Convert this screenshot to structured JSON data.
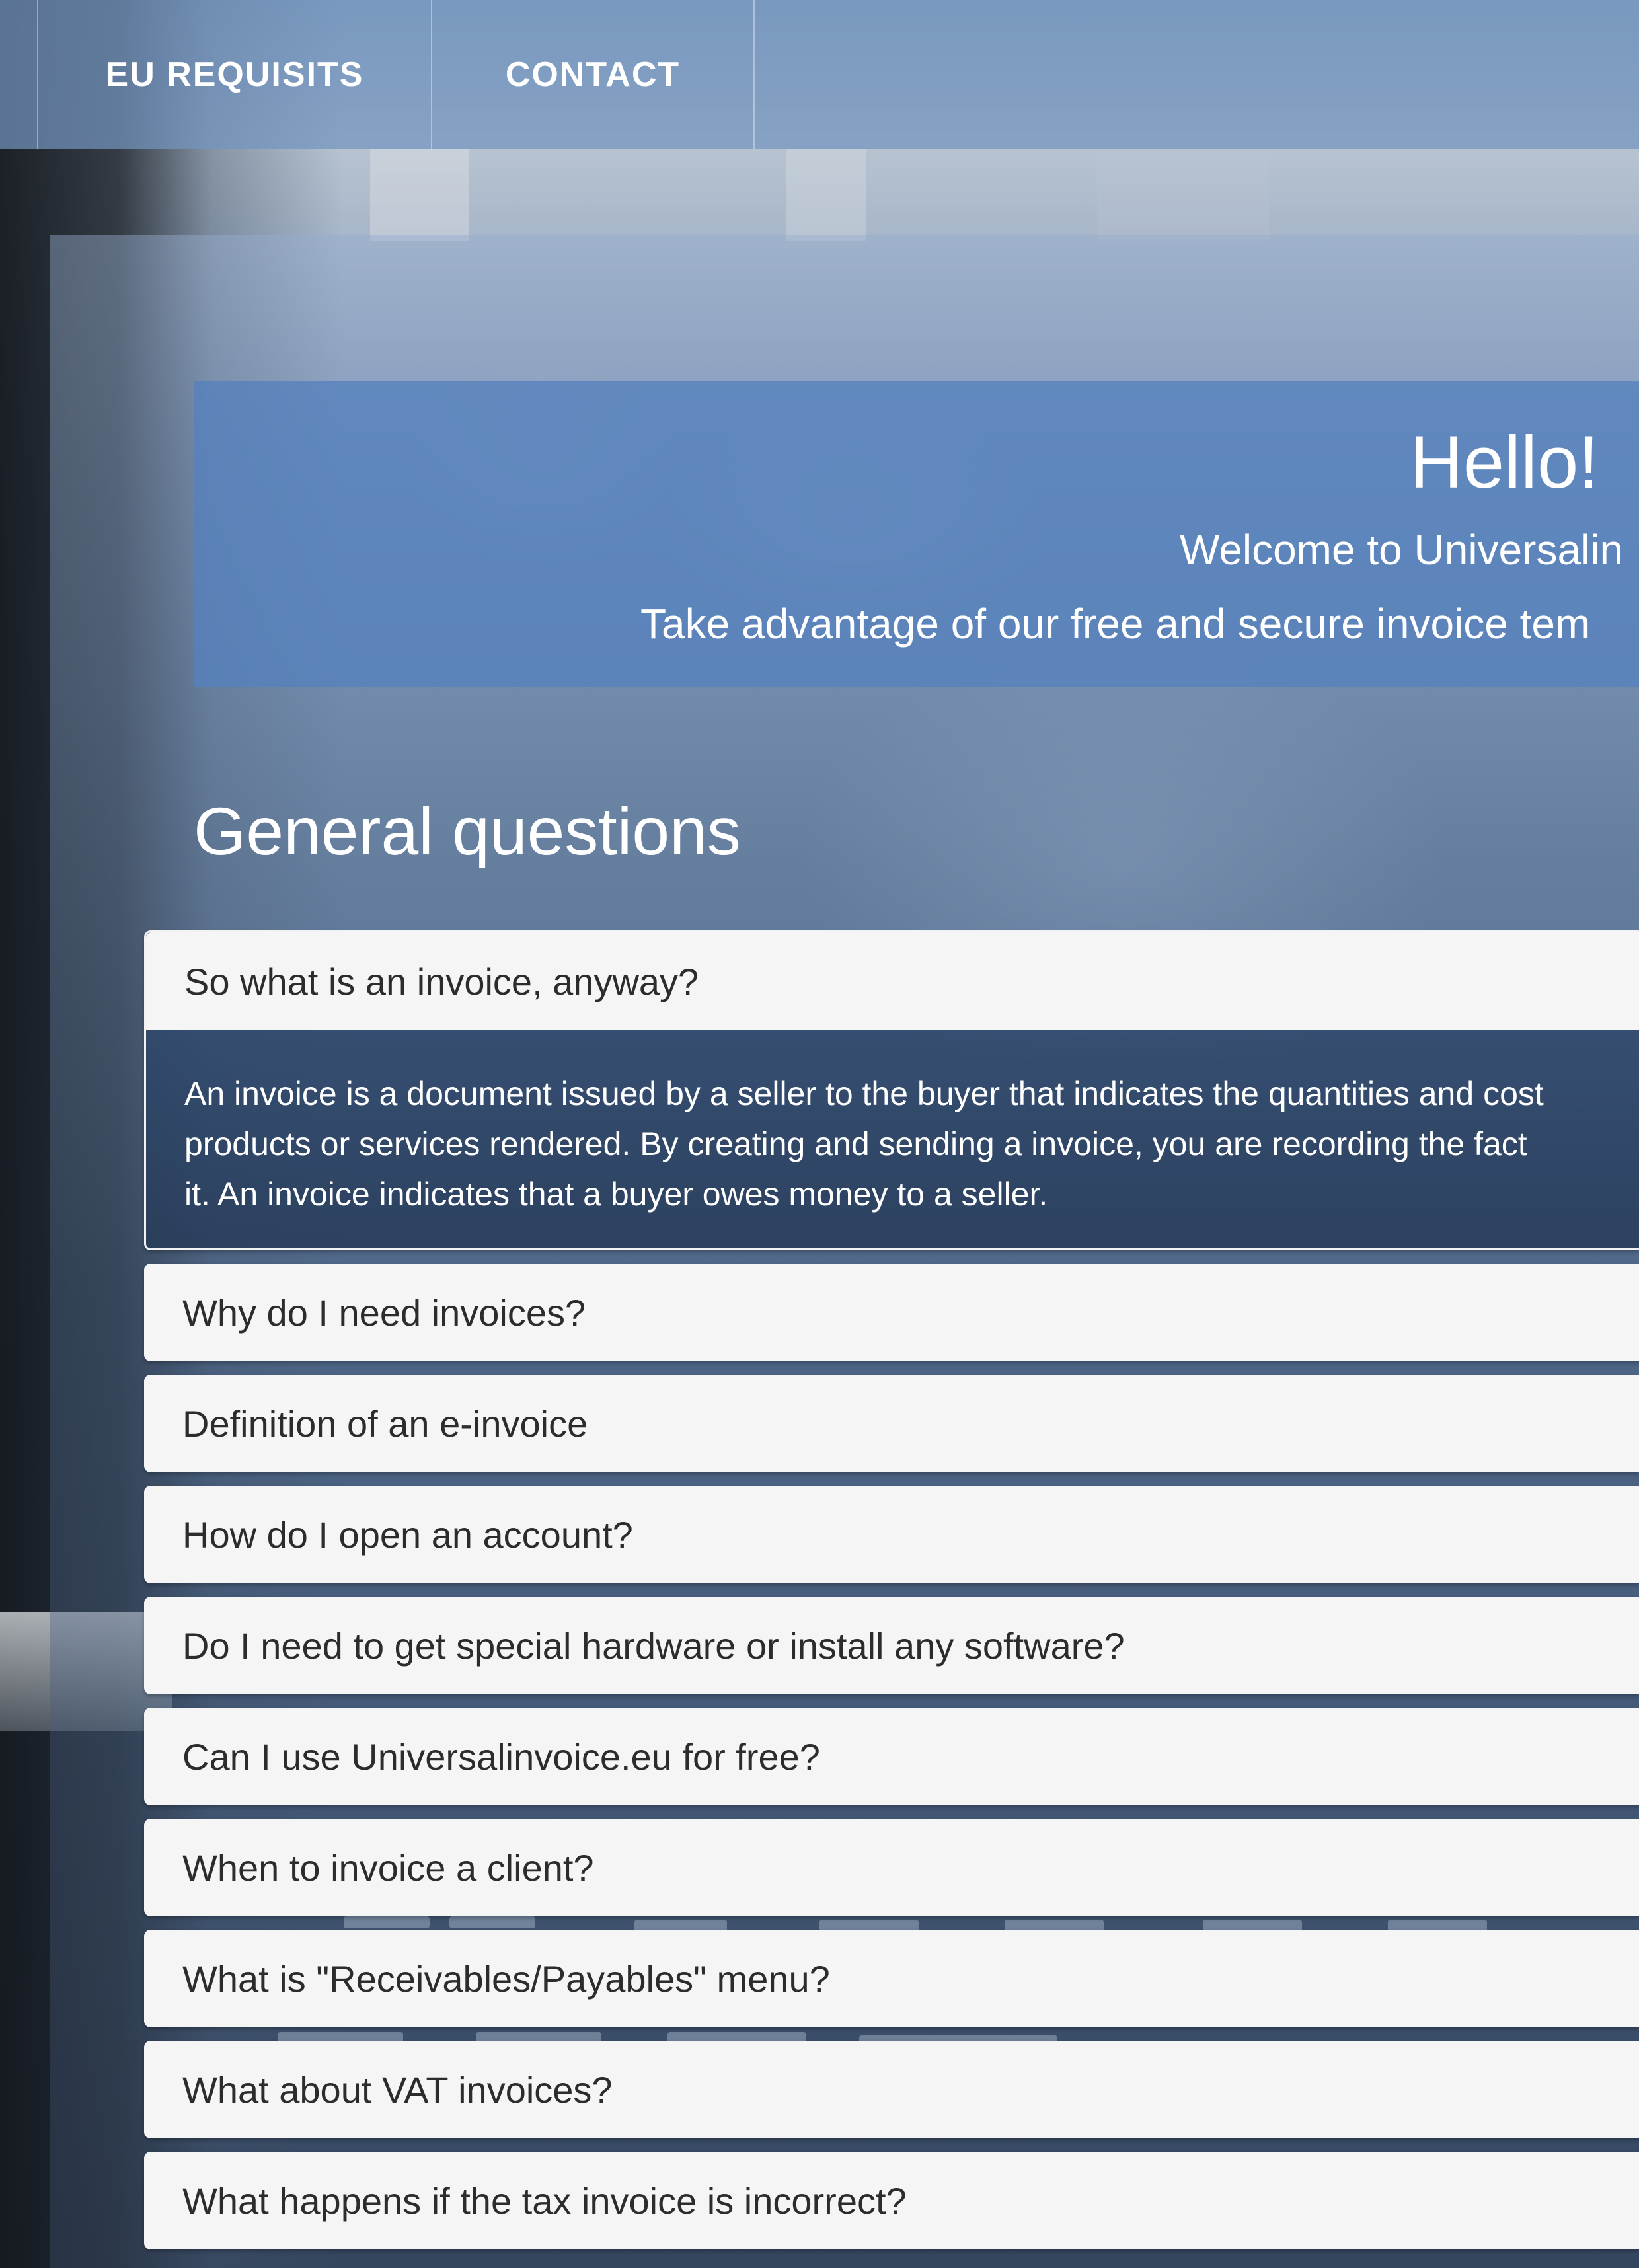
{
  "nav": {
    "items": [
      {
        "label": "EU REQUISITS"
      },
      {
        "label": "CONTACT"
      }
    ]
  },
  "hero": {
    "title": "Hello!",
    "welcome": "Welcome to Universalin",
    "tagline": "Take advantage of our free and secure invoice tem"
  },
  "section": {
    "title": "General questions"
  },
  "faq": {
    "items": [
      {
        "question": "So what is an invoice, anyway?",
        "answer_lines": [
          "An invoice is a document issued by a seller to the buyer that indicates the quantities and cost",
          "products or services rendered. By creating and sending a invoice, you are recording the fact",
          "it. An invoice indicates that a buyer owes money to a seller."
        ]
      },
      {
        "question": "Why do I need invoices?"
      },
      {
        "question": "Definition of an e-invoice"
      },
      {
        "question": "How do I open an account?"
      },
      {
        "question": "Do I need to get special hardware or install any software?"
      },
      {
        "question": "Can I use Universalinvoice.eu for free?"
      },
      {
        "question": "When to invoice a client?"
      },
      {
        "question": "What is \"Receivables/Payables\" menu?"
      },
      {
        "question": "What about VAT invoices?"
      },
      {
        "question": "What happens if the tax invoice is incorrect?"
      }
    ]
  },
  "colors": {
    "nav_background": "#7394be",
    "hero_background": "#5482be",
    "faq_question_background": "#f5f5f5",
    "faq_answer_background": "#2d4669"
  }
}
